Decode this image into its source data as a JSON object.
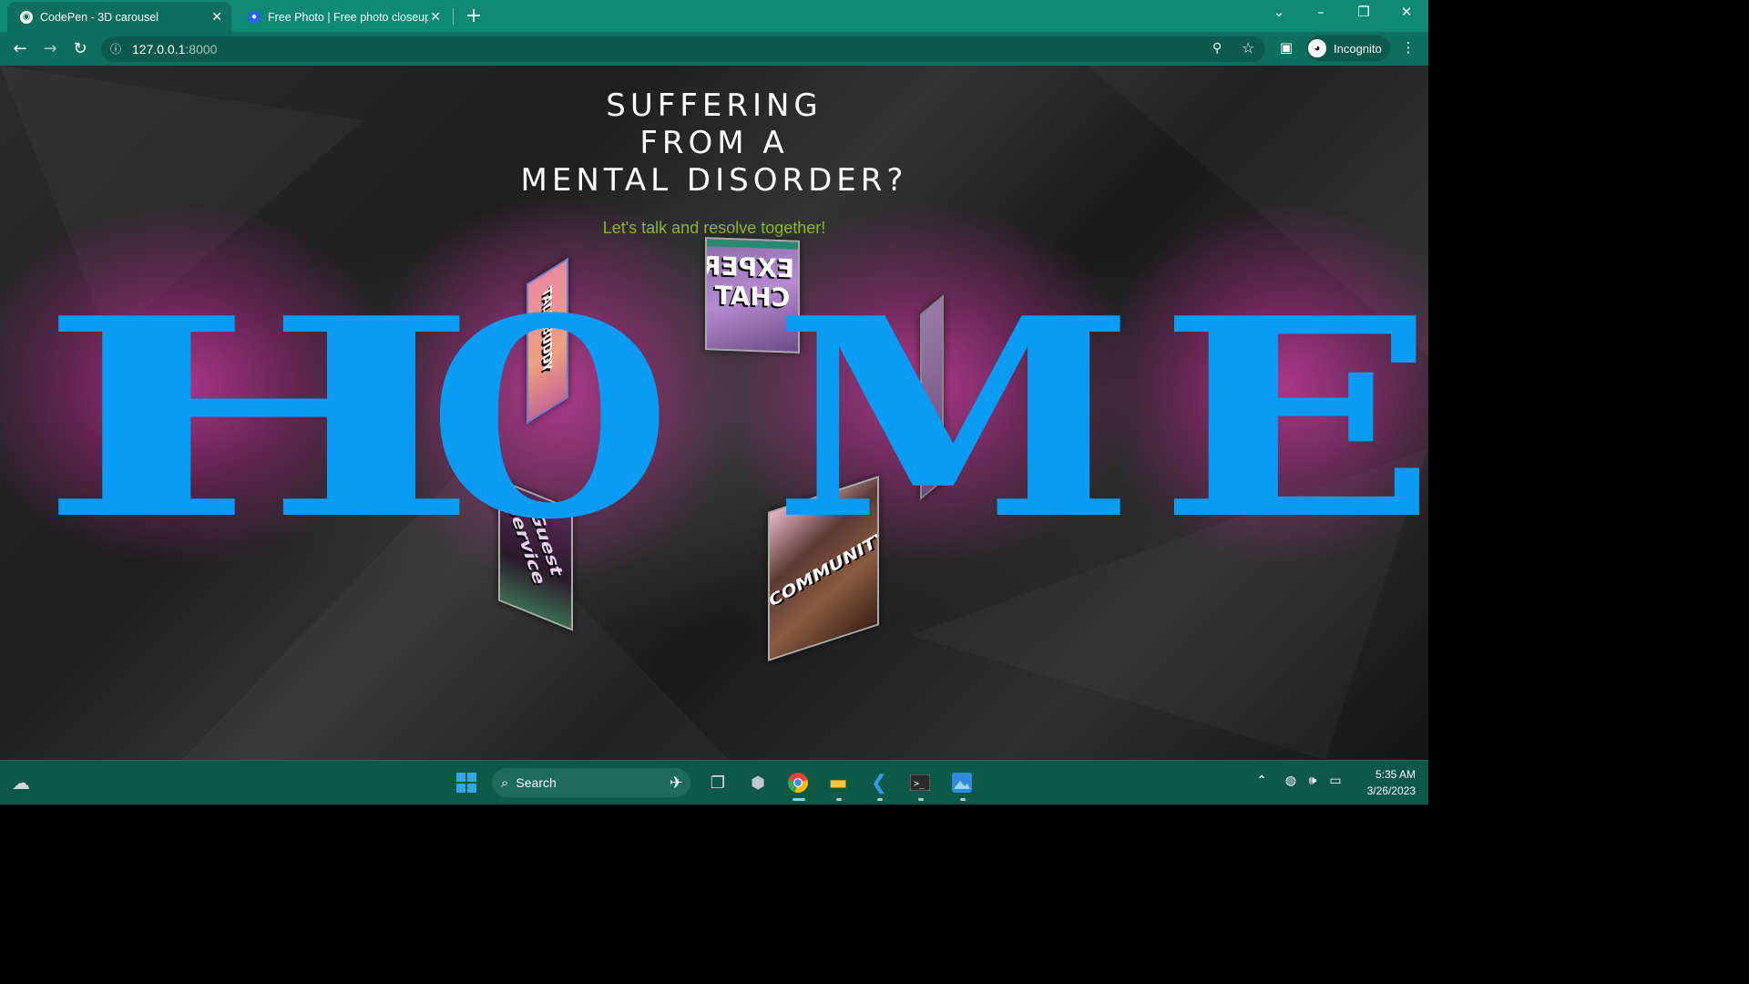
{
  "browser": {
    "tabs": [
      {
        "title": "CodePen - 3D carousel",
        "active": true,
        "icon": "globe-icon"
      },
      {
        "title": "Free Photo | Free photo closeup",
        "active": false,
        "icon": "freepik-icon"
      }
    ],
    "address": {
      "host": "127.0.0.1",
      "port": ":8000"
    },
    "profile_label": "Incognito"
  },
  "page": {
    "heading_lines": [
      "SUFFERING",
      "FROM A",
      "MENTAL DISORDER?"
    ],
    "subtitle": "Let's talk and resolve together!",
    "home_letters": [
      "H",
      "O",
      "M",
      "E"
    ],
    "cards": [
      {
        "label": "EXPERT CHAT",
        "mirrored": true
      },
      {
        "label": "COMMUNITY"
      },
      {
        "label": "Guest Service"
      },
      {
        "label": "TALK BUDDY"
      }
    ],
    "colors": {
      "home": "#0a9bf5",
      "glow": "#d63caa",
      "subtitle": "#8ab82b",
      "chrome": "#0e8a74"
    }
  },
  "taskbar": {
    "search_label": "Search",
    "time": "5:35 AM",
    "date": "3/26/2023",
    "apps": [
      "windows-start-icon",
      "search-icon",
      "widgets-icon",
      "task-view-icon",
      "app-icon",
      "chrome-icon",
      "file-explorer-icon",
      "vscode-icon",
      "terminal-icon",
      "photos-icon"
    ]
  }
}
